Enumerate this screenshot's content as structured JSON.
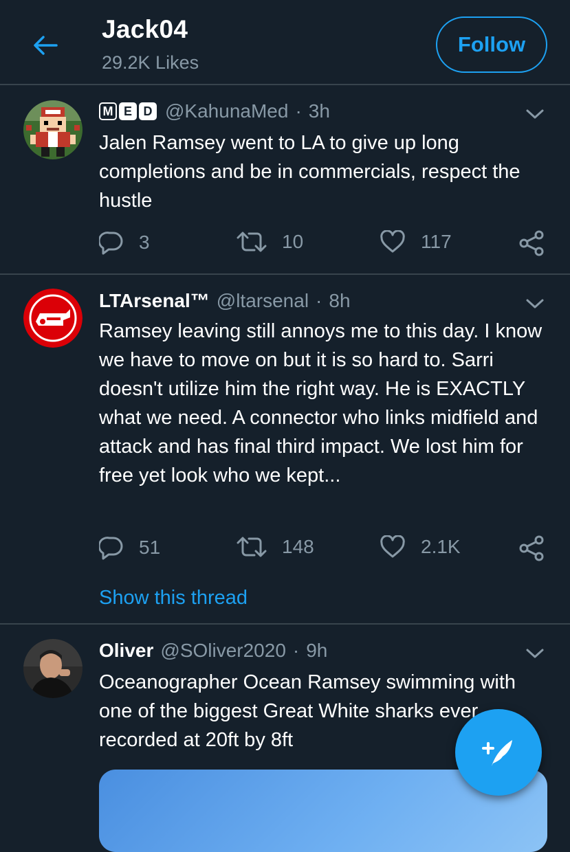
{
  "header": {
    "title": "Jack04",
    "subtitle": "29.2K Likes",
    "follow_label": "Follow"
  },
  "tweets": [
    {
      "badge": [
        "M",
        "E",
        "D"
      ],
      "name": "",
      "handle": "@KahunaMed",
      "dot": "·",
      "time": "3h",
      "text": "Jalen Ramsey went to LA to give up long completions and be in commercials, respect the hustle",
      "replies": "3",
      "retweets": "10",
      "likes": "117"
    },
    {
      "name": "LTArsenal™",
      "handle": "@ltarsenal",
      "dot": "·",
      "time": "8h",
      "text": "Ramsey leaving still annoys me to this day. I know we have to move on but it is so hard to. Sarri doesn't utilize him the right way. He is EXACTLY what we need. A connector who links midfield and attack and has final third impact. We lost him for free yet look who we kept...",
      "replies": "51",
      "retweets": "148",
      "likes": "2.1K",
      "show_thread": "Show this thread"
    },
    {
      "name": "Oliver",
      "handle": "@SOliver2020",
      "dot": "·",
      "time": "9h",
      "text": "Oceanographer Ocean Ramsey swimming with one of the biggest Great White sharks ever recorded at 20ft by 8ft"
    }
  ],
  "colors": {
    "background": "#15202b",
    "accent": "#1da1f2",
    "secondary_text": "#8899a6",
    "divider": "#38444d"
  },
  "icons": [
    "back-arrow-icon",
    "chevron-down-icon",
    "reply-icon",
    "retweet-icon",
    "like-icon",
    "share-icon",
    "compose-tweet-icon"
  ]
}
